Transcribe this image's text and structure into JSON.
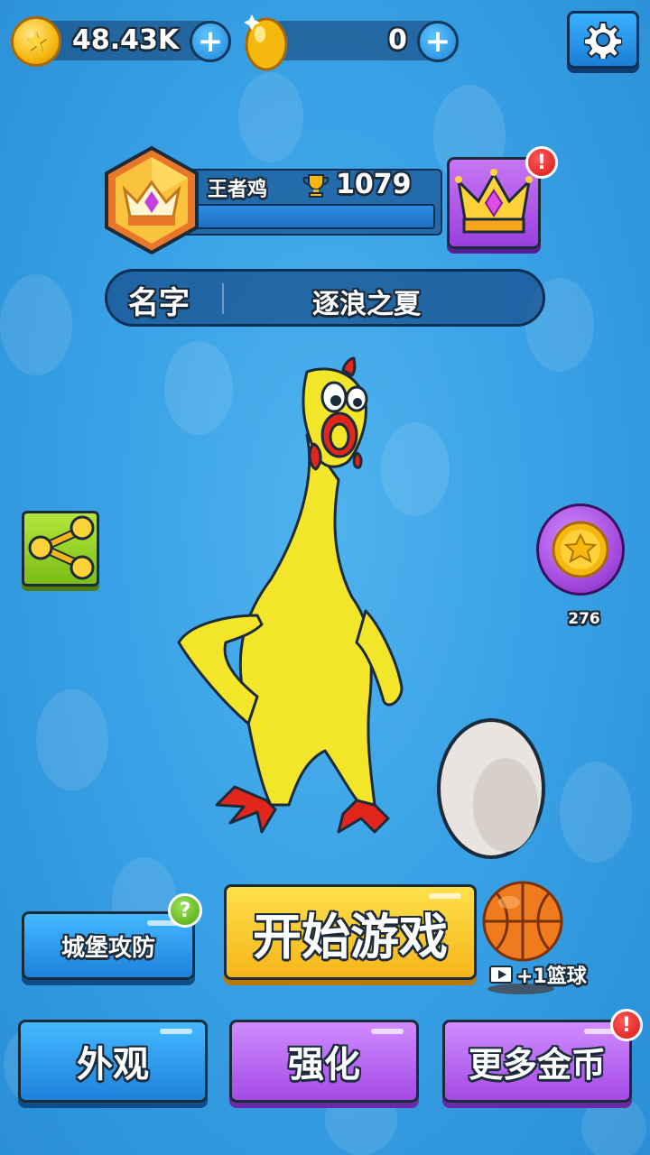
{
  "currency": {
    "coins": "48.43K",
    "eggs": "0"
  },
  "profile": {
    "rank_name": "王者鸡",
    "trophies": "1079"
  },
  "name_bar": {
    "label": "名字",
    "value": "逐浪之夏"
  },
  "badges": {
    "alert": "!",
    "help": "?"
  },
  "coin_reward": {
    "count": "276"
  },
  "actions": {
    "castle_defense": "城堡攻防",
    "start_game": "开始游戏",
    "basketball_reward": "+1篮球",
    "skin": "外观",
    "upgrade": "强化",
    "more_coins": "更多金币"
  },
  "icons": [
    "coin-icon",
    "egg-icon",
    "plus-icon",
    "gear-icon",
    "crown-icon",
    "trophy-icon",
    "share-icon",
    "basketball-icon",
    "video-icon"
  ],
  "colors": {
    "background": "#3aa2e6",
    "start_button": "#f5b51a",
    "purple_button": "#a44ae6",
    "blue_button": "#1c82dc",
    "share_button": "#7cbd17",
    "alert": "#d81616"
  }
}
